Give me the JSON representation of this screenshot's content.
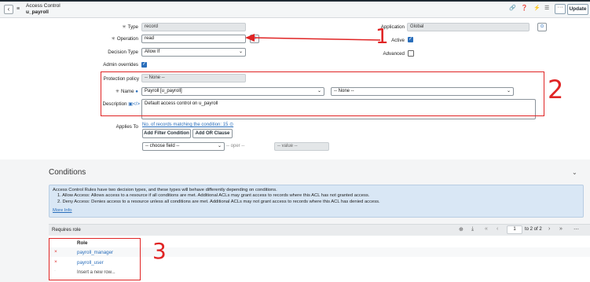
{
  "header": {
    "title": "Access Control",
    "subtitle": "u_payroll",
    "update_label": "Update",
    "more_label": "···"
  },
  "form": {
    "type_label": "Type",
    "type_value": "record",
    "operation_label": "Operation",
    "operation_value": "read",
    "decision_label": "Decision Type",
    "decision_value": "Allow If",
    "admin_overrides_label": "Admin overrides",
    "application_label": "Application",
    "application_value": "Global",
    "active_label": "Active",
    "advanced_label": "Advanced",
    "protection_label": "Protection policy",
    "protection_value": "-- None --",
    "name_label": "Name",
    "name_table_value": "Payroll [u_payroll]",
    "name_field_value": "-- None --",
    "description_label": "Description",
    "description_value": "Default access control on u_payroll",
    "applies_to_label": "Applies To",
    "records_link": "No. of records matching the condition: 15",
    "add_filter_label": "Add Filter Condition",
    "add_or_label": "Add OR Clause",
    "choose_field": "-- choose field --",
    "oper": "-- oper --",
    "value": "-- value --"
  },
  "conditions": {
    "title": "Conditions",
    "info_lines": [
      "Access Control Rules have two decision types, and these types will behave differently depending on conditions.",
      "1. Allow Access: Allows access to a resource if all conditions are met. Additional ACLs may grant access to records where this ACL has not granted access.",
      "2. Deny Access: Denies access to a resource unless all conditions are met. Additional ACLs may not grant access to records where this ACL has denied access."
    ],
    "more_info": "More Info"
  },
  "roles": {
    "bar_label": "Requires role",
    "page_current": "1",
    "page_total": "to 2 of 2",
    "column_header": "Role",
    "rows": [
      "payroll_manager",
      "payroll_user"
    ],
    "insert_row": "Insert a new row..."
  },
  "annotations": {
    "one": "1",
    "two": "2",
    "three": "3"
  },
  "colors": {
    "annotation_red": "#e02424",
    "link_blue": "#2a6ebb",
    "banner_blue": "#d9e7f5"
  }
}
